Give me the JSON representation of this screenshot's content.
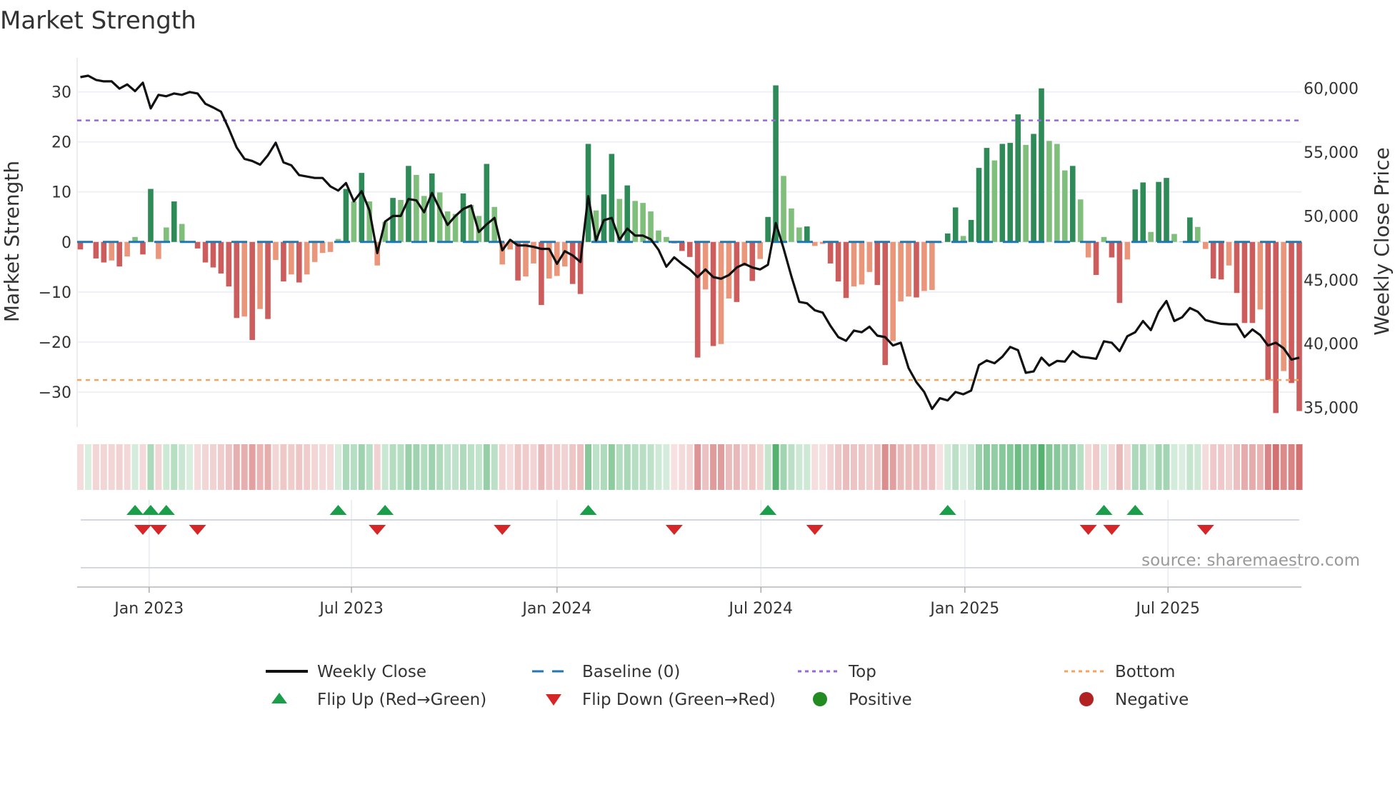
{
  "chart_data": {
    "type": "bar",
    "title": "Market Strength",
    "ylabel": "Market Strength",
    "y2label": "Weekly Close Price",
    "ylim": [
      -37,
      36.8
    ],
    "y2lim": [
      33460,
      62390
    ],
    "yticks": [
      30,
      20,
      10,
      0,
      -10,
      -20,
      -30
    ],
    "y2ticks": [
      {
        "v": 60000,
        "label": "60,000"
      },
      {
        "v": 55000,
        "label": "55,000"
      },
      {
        "v": 50000,
        "label": "50,000"
      },
      {
        "v": 45000,
        "label": "45,000"
      },
      {
        "v": 40000,
        "label": "40,000"
      },
      {
        "v": 35000,
        "label": "35,000"
      }
    ],
    "xticks": [
      {
        "x": 8.8,
        "label": "Jan 2023"
      },
      {
        "x": 34.7,
        "label": "Jul 2023"
      },
      {
        "x": 61.0,
        "label": "Jan 2024"
      },
      {
        "x": 87.1,
        "label": "Jul 2024"
      },
      {
        "x": 113.2,
        "label": "Jan 2025"
      },
      {
        "x": 139.2,
        "label": "Jul 2025"
      }
    ],
    "top_level": 24.3,
    "bottom_level": -27.6,
    "baseline": 0,
    "strength": [
      -1.5,
      0,
      -3.3,
      -4.1,
      -3.7,
      -4.9,
      -2.9,
      1.0,
      -2.5,
      10.6,
      -3.4,
      2.9,
      8.1,
      3.6,
      0,
      -1.3,
      -4.1,
      -5.1,
      -6.3,
      -8.9,
      -15.2,
      -14.9,
      -19.6,
      -13.4,
      -15.4,
      -3.6,
      -7.9,
      -6.5,
      -8.1,
      -6.5,
      -4.0,
      -2.2,
      -2.0,
      0.6,
      10.6,
      8.1,
      13.8,
      8.1,
      -4.7,
      4.0,
      8.8,
      8.4,
      15.2,
      13.4,
      9.2,
      13.7,
      9.9,
      6.1,
      5.6,
      9.7,
      7.4,
      5.2,
      15.6,
      7.0,
      -4.5,
      -1.5,
      -7.7,
      -6.9,
      -4.3,
      -12.6,
      -7.3,
      -6.8,
      -4.9,
      -8.4,
      -10.4,
      19.6,
      6.3,
      9.5,
      17.6,
      8.6,
      11.3,
      8.2,
      7.8,
      6.1,
      2.3,
      1.0,
      -0.3,
      -1.8,
      -3.0,
      -23.1,
      -9.5,
      -20.8,
      -20.4,
      -11.3,
      -12.0,
      -4.8,
      -7.8,
      -3.4,
      5.0,
      31.3,
      13.2,
      6.7,
      2.9,
      3.1,
      -0.8,
      -0.4,
      -4.3,
      -7.9,
      -11.2,
      -8.9,
      -8.5,
      -6.0,
      -8.6,
      -24.6,
      -19.8,
      -11.9,
      -10.9,
      -11.1,
      -9.8,
      -9.6,
      -0.2,
      1.7,
      6.9,
      1.2,
      4.4,
      14.8,
      18.8,
      16.3,
      19.6,
      19.8,
      25.5,
      19.4,
      21.6,
      30.7,
      20.2,
      19.6,
      14.3,
      15.2,
      8.5,
      -3.1,
      -6.6,
      1.0,
      -3.1,
      -12.2,
      -3.5,
      10.5,
      11.9,
      2.0,
      12.0,
      12.8,
      1.6,
      0.1,
      4.9,
      3.0,
      -1.4,
      -7.3,
      -7.5,
      -4.7,
      -10.2,
      -16.2,
      -16.2,
      -13.5,
      -27.6,
      -34.2,
      -25.8,
      -28.2,
      -33.8
    ],
    "weekly_close": [
      60880,
      60990,
      60660,
      60550,
      60550,
      59980,
      60310,
      59780,
      60440,
      58430,
      59490,
      59380,
      59600,
      59490,
      59710,
      59600,
      58790,
      58500,
      58170,
      56840,
      55370,
      54480,
      54310,
      54020,
      54750,
      55740,
      54200,
      53970,
      53200,
      53090,
      52980,
      52980,
      52320,
      51990,
      52580,
      51150,
      51940,
      50440,
      47090,
      49560,
      50000,
      50000,
      51330,
      51220,
      50290,
      51810,
      50550,
      49300,
      50000,
      50550,
      50820,
      48740,
      49340,
      49850,
      47310,
      48130,
      47690,
      47690,
      47580,
      47420,
      47420,
      46250,
      47240,
      46910,
      46400,
      51550,
      48080,
      49670,
      49850,
      48130,
      49010,
      48460,
      48460,
      48170,
      47350,
      46030,
      46760,
      46250,
      45810,
      45210,
      45810,
      45210,
      45080,
      45370,
      45960,
      46250,
      45960,
      45810,
      46180,
      49450,
      47460,
      45260,
      43270,
      43160,
      42610,
      42430,
      41390,
      40510,
      40220,
      41020,
      40890,
      41330,
      40620,
      40510,
      39850,
      40070,
      38080,
      36980,
      36210,
      34880,
      35720,
      35550,
      36210,
      36030,
      36320,
      38310,
      38680,
      38460,
      38970,
      39740,
      39480,
      37710,
      37820,
      38900,
      38280,
      38640,
      38590,
      39410,
      38970,
      38900,
      38810,
      40180,
      40070,
      39410,
      40580,
      40890,
      41770,
      41060,
      42500,
      43340,
      41770,
      42060,
      42790,
      42500,
      41840,
      41680,
      41550,
      41510,
      41510,
      40510,
      41110,
      40670,
      39850,
      40070,
      39630,
      38750,
      38900
    ],
    "flip_up": [
      7,
      9,
      11,
      33,
      39,
      65,
      88,
      111,
      131,
      135
    ],
    "flip_down": [
      8,
      10,
      15,
      38,
      54,
      76,
      94,
      129,
      132,
      144
    ],
    "legend": {
      "weekly_close": "Weekly Close",
      "baseline": "Baseline (0)",
      "top": "Top",
      "bottom": "Bottom",
      "flip_up": "Flip Up (Red→Green)",
      "flip_down": "Flip Down (Green→Red)",
      "positive": "Positive",
      "negative": "Negative"
    },
    "legend_position": "bottom",
    "grid": true,
    "source": "source: sharemaestro.com",
    "colors": {
      "pos_strong": "#2e8b57",
      "pos_weak": "#7fbf7b",
      "neg_strong": "#cd5c5c",
      "neg_weak": "#e9967a",
      "line": "#111111",
      "baseline": "#1f77b4",
      "top": "#9966dd",
      "bottom": "#f4a460",
      "flip_up": "#1a9e4a",
      "flip_down": "#d62728",
      "positive": "#228b22",
      "negative": "#b22222"
    }
  }
}
